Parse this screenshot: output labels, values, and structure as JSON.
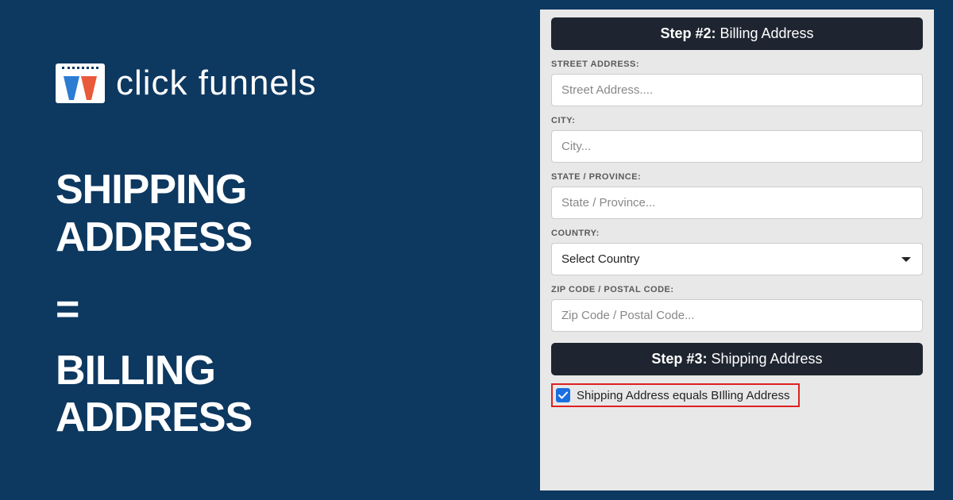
{
  "logo": {
    "text": "click funnels"
  },
  "headline": {
    "line1": "SHIPPING",
    "line2": "ADDRESS",
    "equals": "=",
    "line3": "BILLING",
    "line4": "ADDRESS"
  },
  "form": {
    "step2": {
      "bold": "Step #2:",
      "light": " Billing Address"
    },
    "street": {
      "label": "STREET ADDRESS:",
      "placeholder": "Street Address...."
    },
    "city": {
      "label": "CITY:",
      "placeholder": "City..."
    },
    "state": {
      "label": "STATE / PROVINCE:",
      "placeholder": "State / Province..."
    },
    "country": {
      "label": "COUNTRY:",
      "selected": "Select Country"
    },
    "zip": {
      "label": "ZIP CODE / POSTAL CODE:",
      "placeholder": "Zip Code / Postal Code..."
    },
    "step3": {
      "bold": "Step #3:",
      "light": " Shipping Address"
    },
    "checkbox": {
      "label": "Shipping Address equals BIlling Address",
      "checked": true
    }
  }
}
